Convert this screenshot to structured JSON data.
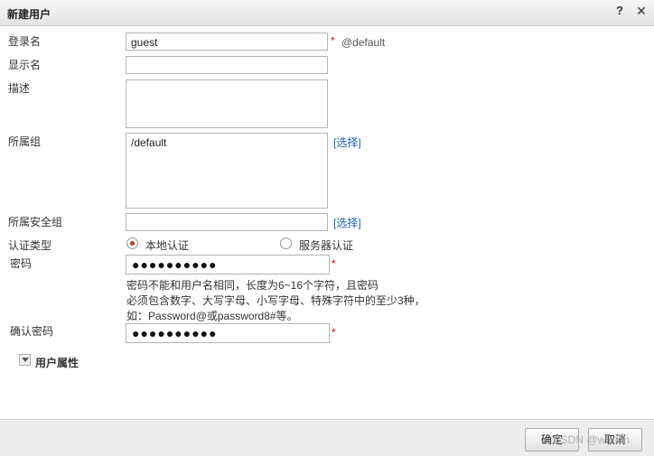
{
  "dialog": {
    "title": "新建用户",
    "help_icon": "?",
    "close_icon": "✕"
  },
  "form": {
    "login_label": "登录名",
    "login_value": "guest",
    "login_suffix": "@default",
    "display_label": "显示名",
    "display_value": "",
    "desc_label": "描述",
    "desc_value": "",
    "group_label": "所属组",
    "group_value": "/default",
    "group_select_link": "[选择]",
    "security_group_label": "所属安全组",
    "security_group_value": "",
    "security_group_select_link": "[选择]",
    "auth_type_label": "认证类型",
    "auth_options": [
      {
        "label": "本地认证",
        "selected": true
      },
      {
        "label": "服务器认证",
        "selected": false
      }
    ],
    "password_label": "密码",
    "password_value": "●●●●●●●●●●",
    "password_hint_lines": [
      "密码不能和用户名相同，长度为6~16个字符，且密码",
      "必须包含数字、大写字母、小写字母、特殊字符中的至少3种，",
      "如：Password@或password8#等。"
    ],
    "confirm_password_label": "确认密码",
    "confirm_password_value": "●●●●●●●●●●",
    "required_mark": "*"
  },
  "section": {
    "user_attributes_label": "用户属性",
    "expanded": false
  },
  "footer": {
    "ok_label": "确定",
    "cancel_label": "取消",
    "watermark": "CSDN @wtt-ien"
  },
  "colors": {
    "required": "#ee0000",
    "link": "#1a5fb4",
    "radio_selected": "#c0392b"
  }
}
